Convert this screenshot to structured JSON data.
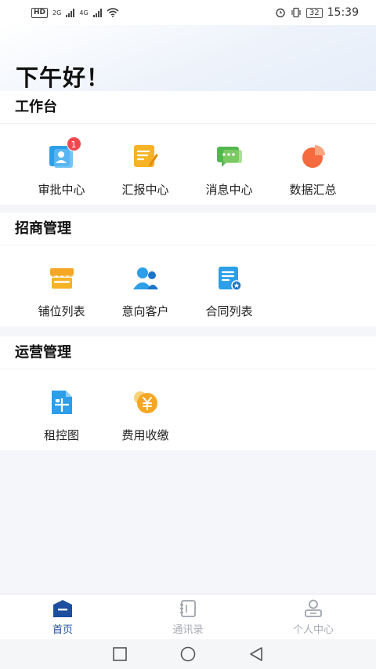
{
  "status_bar": {
    "left_tags": [
      "HD",
      "2G",
      "4G"
    ],
    "battery": "32",
    "time": "15:39"
  },
  "greeting": "下午好！",
  "sections": [
    {
      "title": "工作台",
      "items": [
        {
          "label": "审批中心",
          "icon": "approval-icon",
          "badge": "1"
        },
        {
          "label": "汇报中心",
          "icon": "report-icon"
        },
        {
          "label": "消息中心",
          "icon": "message-icon"
        },
        {
          "label": "数据汇总",
          "icon": "pie-chart-icon"
        }
      ]
    },
    {
      "title": "招商管理",
      "items": [
        {
          "label": "铺位列表",
          "icon": "shop-icon"
        },
        {
          "label": "意向客户",
          "icon": "customers-icon"
        },
        {
          "label": "合同列表",
          "icon": "contract-icon"
        }
      ]
    },
    {
      "title": "运营管理",
      "items": [
        {
          "label": "租控图",
          "icon": "floor-plan-icon"
        },
        {
          "label": "费用收缴",
          "icon": "yuan-coin-icon"
        }
      ]
    }
  ],
  "tabbar": [
    {
      "label": "首页",
      "icon": "home-icon",
      "active": true
    },
    {
      "label": "通讯录",
      "icon": "contacts-icon",
      "active": false
    },
    {
      "label": "个人中心",
      "icon": "person-icon",
      "active": false
    }
  ],
  "colors": {
    "accent": "#1d4f9e",
    "badge": "#f2474d",
    "inactive_tab": "#a8acb3"
  }
}
